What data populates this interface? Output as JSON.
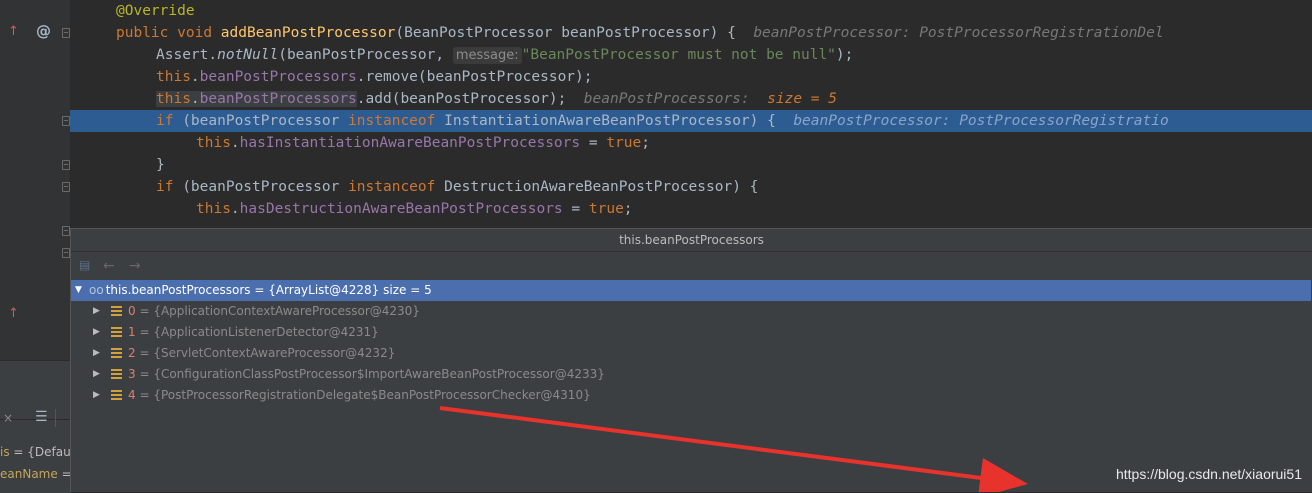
{
  "gutter": {
    "override_marker": "@"
  },
  "code_lines": {
    "l0": {
      "annotation": "@Override"
    },
    "l1": {
      "kw_public": "public",
      "kw_void": "void",
      "method": "addBeanPostProcessor",
      "sig": "(BeanPostProcessor beanPostProcessor) {",
      "hint": "beanPostProcessor: PostProcessorRegistrationDel"
    },
    "l2": {
      "pre": "Assert.",
      "call": "notNull",
      "args1": "(beanPostProcessor,",
      "param_hint": "message:",
      "string": "\"BeanPostProcessor must not be null\"",
      "end": ");"
    },
    "l3": {
      "kw_this": "this",
      "dot": ".",
      "field": "beanPostProcessors",
      "rest": ".remove(beanPostProcessor);"
    },
    "l4": {
      "kw_this": "this",
      "dot": ".",
      "field": "beanPostProcessors",
      "rest": ".add(beanPostProcessor);",
      "hint_name": "beanPostProcessors:",
      "hint_val": "size = 5"
    },
    "l5": {
      "kw_if": "if",
      "pre": "(beanPostProcessor",
      "kw_inst": "instanceof",
      "type": "InstantiationAwareBeanPostProcessor) {",
      "hint": "beanPostProcessor: PostProcessorRegistratio"
    },
    "l6": {
      "kw_this": "this",
      "dot": ".",
      "field": "hasInstantiationAwareBeanPostProcessors",
      "eq": " = ",
      "kw_true": "true",
      "end": ";"
    },
    "l7": {
      "brace": "}"
    },
    "l8": {
      "kw_if": "if",
      "pre": "(beanPostProcessor",
      "kw_inst": "instanceof",
      "type": "DestructionAwareBeanPostProcessor) {"
    },
    "l9": {
      "kw_this": "this",
      "dot": ".",
      "field": "hasDestructionAwareBeanPostProcessors",
      "eq": " = ",
      "kw_true": "true",
      "end": ";"
    }
  },
  "popup": {
    "title": "this.beanPostProcessors",
    "nav": {
      "back": "←",
      "forward": "→"
    },
    "root": {
      "name": "this.beanPostProcessors",
      "value": " = {ArrayList@4228}  size = 5"
    },
    "items": [
      {
        "index": "0",
        "value": " = {ApplicationContextAwareProcessor@4230}"
      },
      {
        "index": "1",
        "value": " = {ApplicationListenerDetector@4231}"
      },
      {
        "index": "2",
        "value": " = {ServletContextAwareProcessor@4232}"
      },
      {
        "index": "3",
        "value": " = {ConfigurationClassPostProcessor$ImportAwareBeanPostProcessor@4233}"
      },
      {
        "index": "4",
        "value": " = {PostProcessorRegistrationDelegate$BeanPostProcessorChecker@4310}"
      }
    ]
  },
  "variables_panel": {
    "close_glyph": "×",
    "v1": {
      "name": "is",
      "value": " = {Defau"
    },
    "v2": {
      "name": "eanName",
      "value": " ="
    }
  },
  "watermark": "https://blog.csdn.net/xiaorui51",
  "colors": {
    "keyword": "#cc7832",
    "method": "#ffc66d",
    "field": "#9876aa",
    "string": "#6a8759",
    "annotation": "#bbb529",
    "selection": "#4b6eaf",
    "arrow": "#e8322c"
  }
}
